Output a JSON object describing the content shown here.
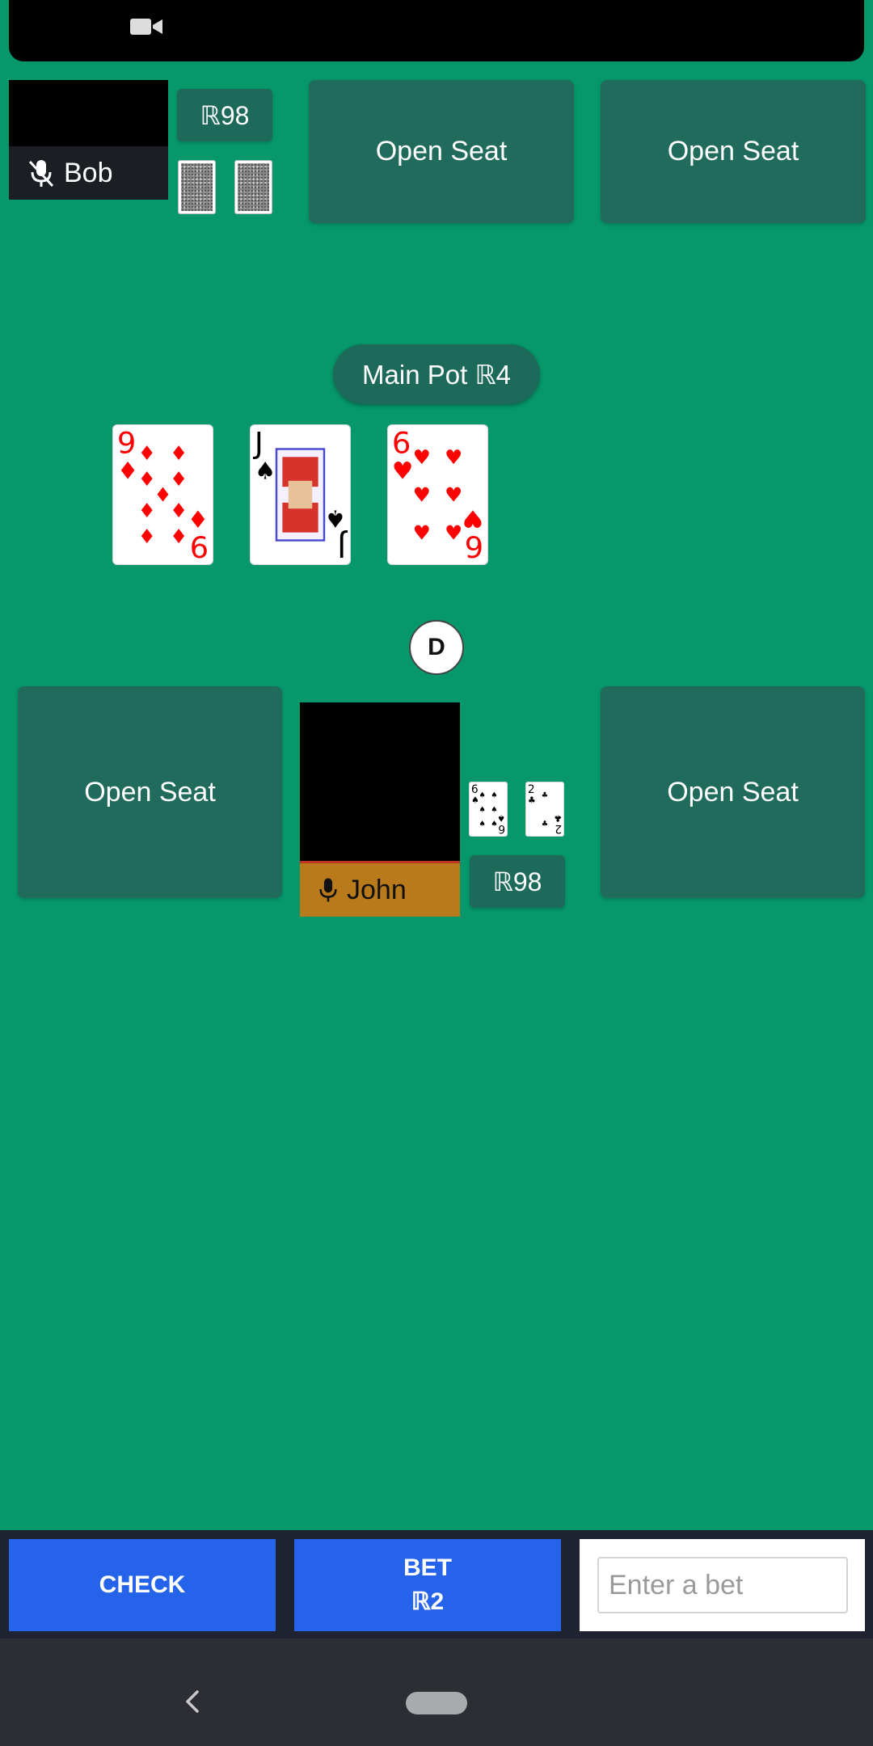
{
  "status_bar": {
    "icon": "video-camera-icon"
  },
  "players": {
    "bob": {
      "name": "Bob",
      "chips": "ℝ98",
      "mic_icon": "mic-off-icon"
    },
    "john": {
      "name": "John",
      "chips": "ℝ98",
      "mic_icon": "mic-icon"
    }
  },
  "seats": {
    "top_center": "Open Seat",
    "top_right": "Open Seat",
    "bottom_left": "Open Seat",
    "bottom_right": "Open Seat"
  },
  "table": {
    "pot_label": "Main Pot ℝ4",
    "dealer_button": "D",
    "community_cards": [
      {
        "rank": "9",
        "suit": "diamonds",
        "suit_glyph": "♦",
        "color": "#ff0000"
      },
      {
        "rank": "J",
        "suit": "spades",
        "suit_glyph": "♠",
        "color": "#000000"
      },
      {
        "rank": "6",
        "suit": "hearts",
        "suit_glyph": "♥",
        "color": "#ff0000"
      }
    ],
    "hole_cards": [
      {
        "rank": "6",
        "suit": "spades",
        "suit_glyph": "♠",
        "color": "#000000"
      },
      {
        "rank": "2",
        "suit": "clubs",
        "suit_glyph": "♣",
        "color": "#000000"
      }
    ]
  },
  "actions": {
    "check_label": "CHECK",
    "bet_label_line1": "BET",
    "bet_label_line2": "ℝ2",
    "bet_input_placeholder": "Enter a bet"
  },
  "colors": {
    "table_felt": "#06976a",
    "seat_tile": "#206b5b",
    "action_button": "#2563eb",
    "active_player_bar": "#b87a1a"
  },
  "nav": {
    "back_icon": "back-chevron-icon",
    "home_icon": "home-pill-icon"
  }
}
